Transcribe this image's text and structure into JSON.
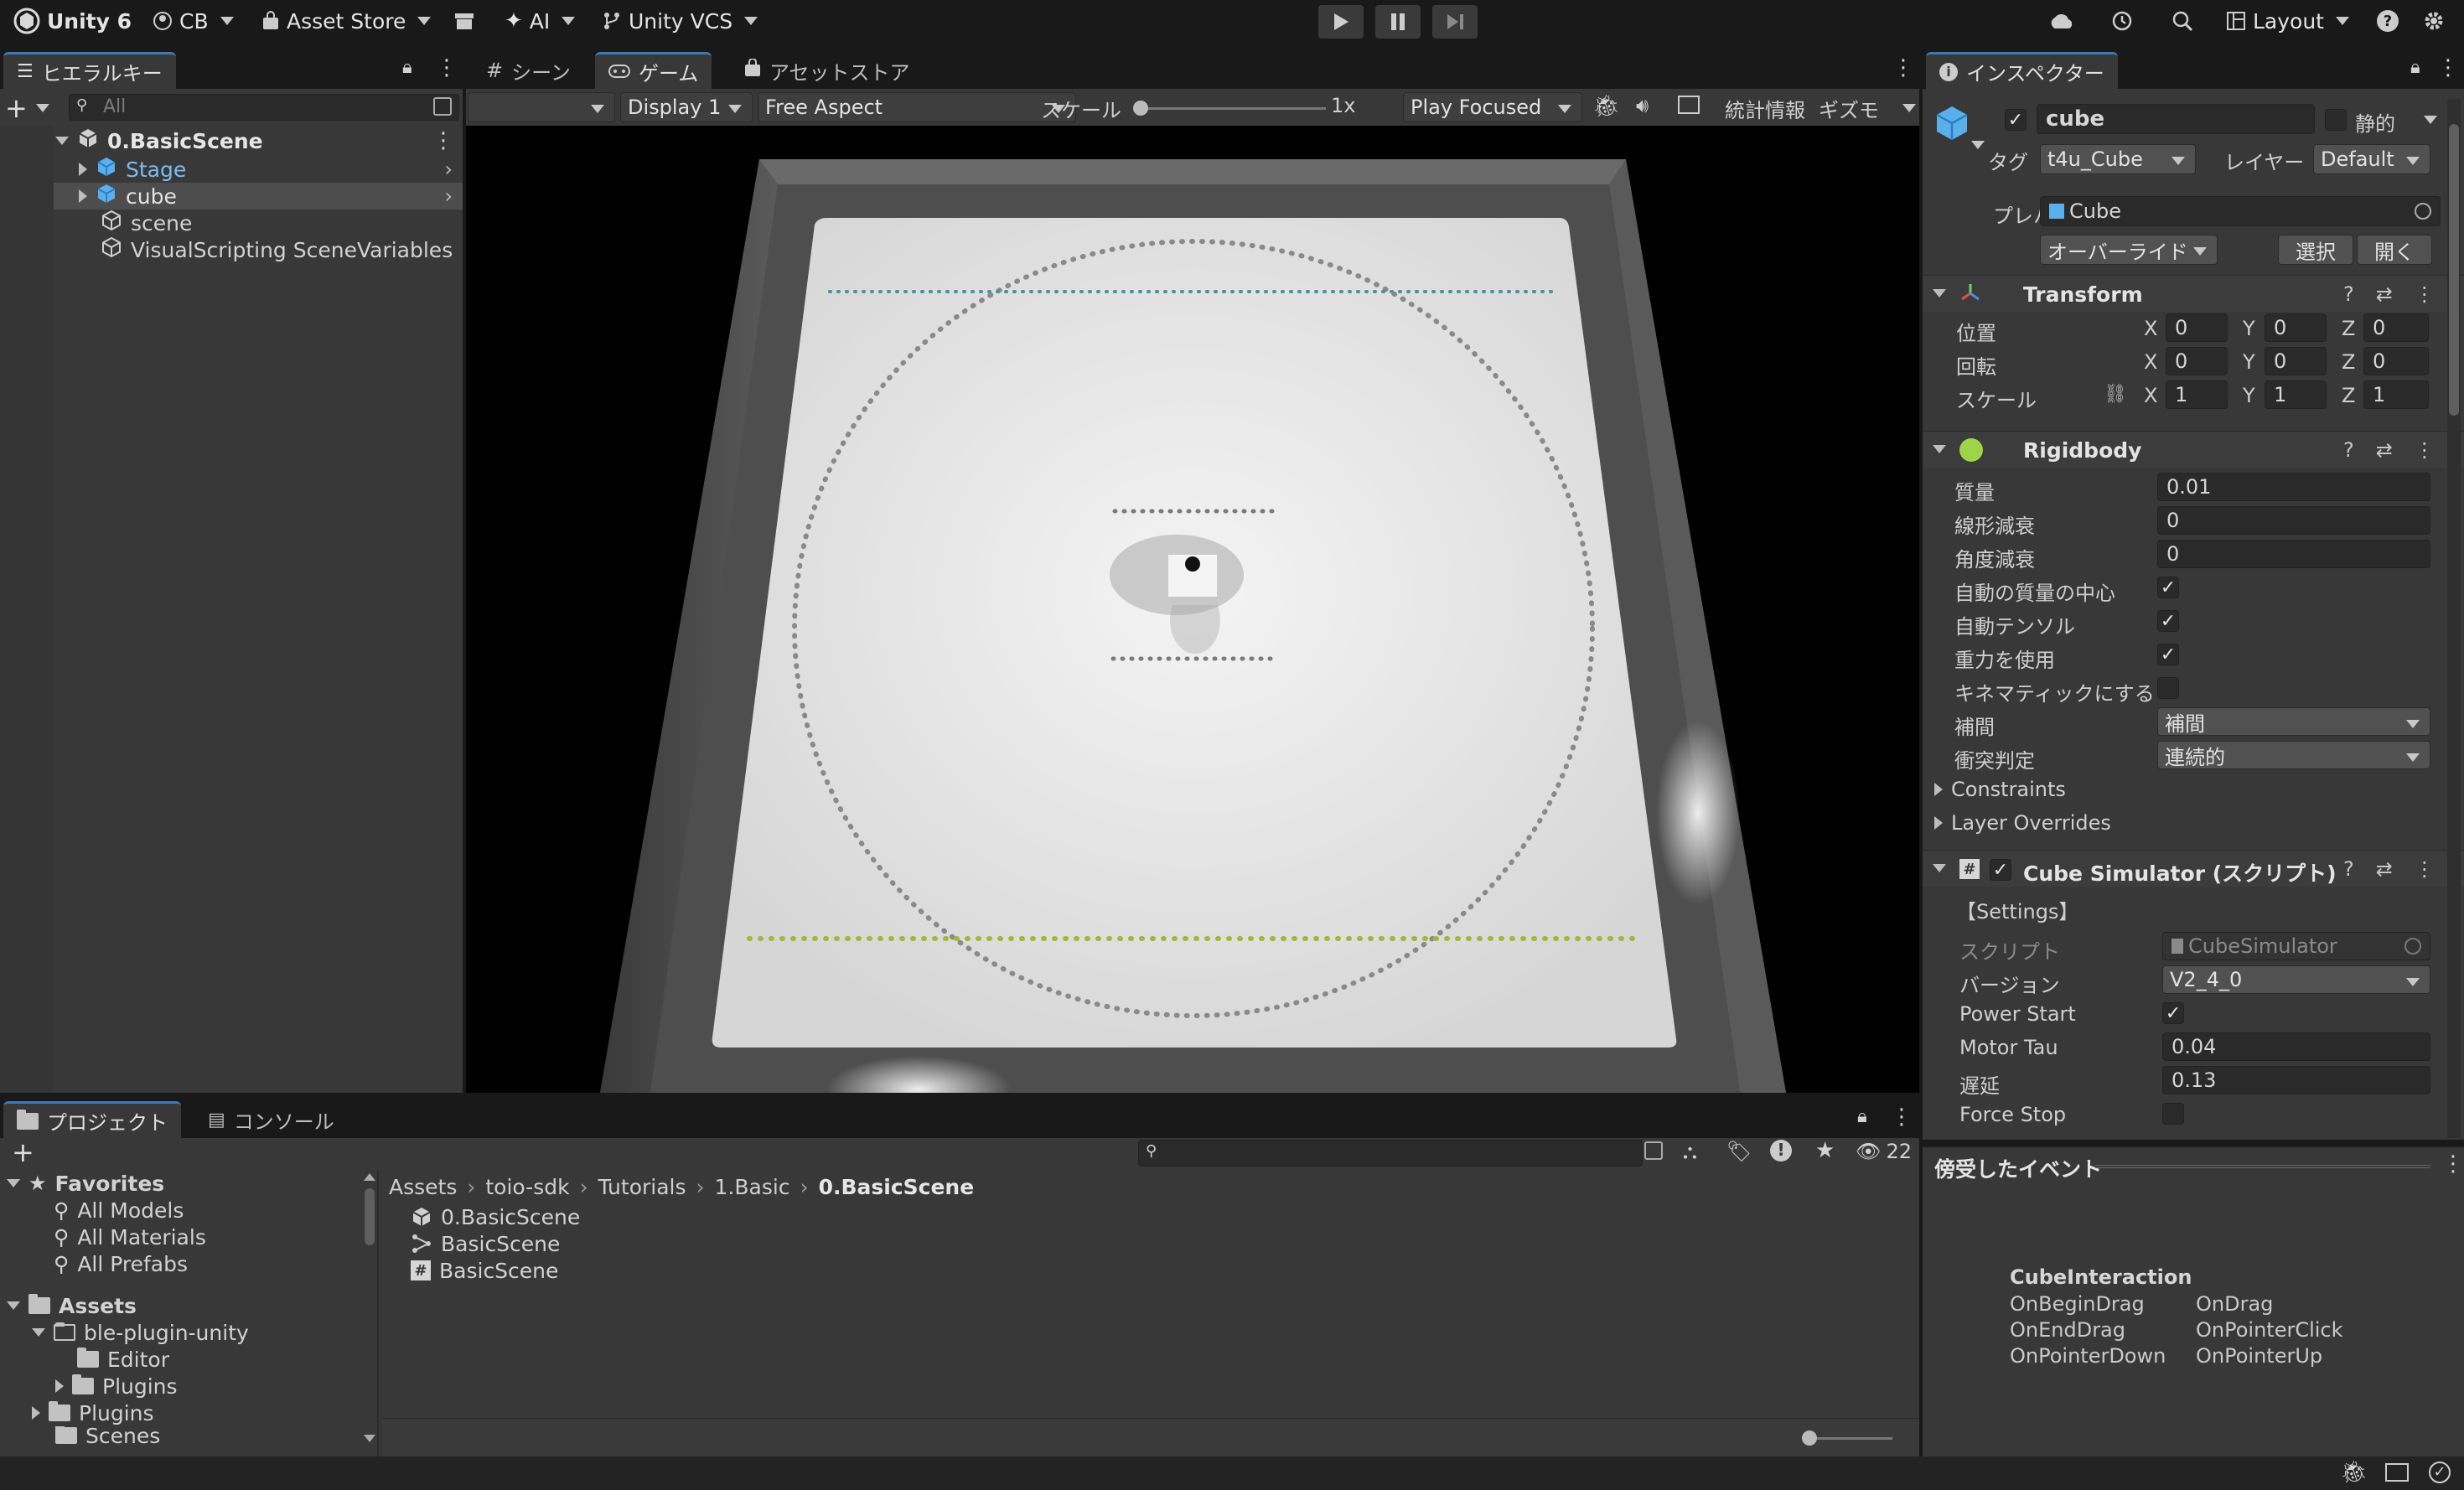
{
  "toolbar": {
    "product": "Unity 6",
    "account": "CB",
    "asset_store": "Asset Store",
    "ai": "AI",
    "vcs": "Unity VCS",
    "layout": "Layout"
  },
  "hierarchy": {
    "tab": "ヒエラルキー",
    "search_placeholder": "All",
    "scene": "0.BasicScene",
    "items": [
      {
        "label": "Stage",
        "type": "prefab"
      },
      {
        "label": "cube",
        "type": "prefab"
      },
      {
        "label": "scene",
        "type": "object"
      },
      {
        "label": "VisualScripting SceneVariables",
        "type": "object"
      }
    ]
  },
  "center_tabs": {
    "scene": "シーン",
    "game": "ゲーム",
    "asset_store": "アセットストア"
  },
  "game_toolbar": {
    "display": "Display 1",
    "aspect": "Free Aspect",
    "scale_label": "スケール",
    "scale_value": "1x",
    "play_mode": "Play Focused",
    "stats": "統計情報",
    "gizmos": "ギズモ"
  },
  "inspector": {
    "tab": "インスペクター",
    "object_name": "cube",
    "static_label": "静的",
    "tag_label": "タグ",
    "tag_value": "t4u_Cube",
    "layer_label": "レイヤー",
    "layer_value": "Default",
    "prefab_label": "プレハブ",
    "prefab_value": "Cube",
    "overrides": "オーバーライド",
    "select": "選択",
    "open": "開く",
    "transform": {
      "title": "Transform",
      "position_label": "位置",
      "rotation_label": "回転",
      "scale_label": "スケール",
      "position": [
        "0",
        "0",
        "0"
      ],
      "rotation": [
        "0",
        "0",
        "0"
      ],
      "scale": [
        "1",
        "1",
        "1"
      ]
    },
    "rigidbody": {
      "title": "Rigidbody",
      "mass_label": "質量",
      "mass": "0.01",
      "linear_damping_label": "線形減衰",
      "linear_damping": "0",
      "angular_damping_label": "角度減衰",
      "angular_damping": "0",
      "auto_center_label": "自動の質量の中心",
      "auto_tensor_label": "自動テンソル",
      "use_gravity_label": "重力を使用",
      "is_kinematic_label": "キネマティックにする",
      "interpolate_label": "補間",
      "interpolate_value": "補間",
      "collision_label": "衝突判定",
      "collision_value": "連続的",
      "constraints": "Constraints",
      "layer_overrides": "Layer Overrides"
    },
    "cube_simulator": {
      "title": "Cube Simulator (スクリプト)",
      "settings": "【Settings】",
      "script_label": "スクリプト",
      "script_value": "CubeSimulator",
      "version_label": "バージョン",
      "version_value": "V2_4_0",
      "power_start_label": "Power Start",
      "motor_tau_label": "Motor Tau",
      "motor_tau": "0.04",
      "delay_label": "遅延",
      "delay": "0.13",
      "force_stop_label": "Force Stop"
    },
    "events": {
      "title": "傍受したイベント",
      "group": "CubeInteraction",
      "left": [
        "OnBeginDrag",
        "OnEndDrag",
        "OnPointerDown"
      ],
      "right": [
        "OnDrag",
        "OnPointerClick",
        "OnPointerUp"
      ]
    }
  },
  "project": {
    "tab": "プロジェクト",
    "console_tab": "コンソール",
    "count": "22",
    "favorites": "Favorites",
    "favorites_items": [
      "All Models",
      "All Materials",
      "All Prefabs"
    ],
    "assets": "Assets",
    "tree": [
      "ble-plugin-unity",
      "Editor",
      "Plugins",
      "Plugins",
      "Scenes"
    ],
    "breadcrumb": [
      "Assets",
      "toio-sdk",
      "Tutorials",
      "1.Basic",
      "0.BasicScene"
    ],
    "files": [
      {
        "name": "0.BasicScene",
        "icon": "unity-scene-icon"
      },
      {
        "name": "BasicScene",
        "icon": "graph-icon"
      },
      {
        "name": "BasicScene",
        "icon": "script-icon"
      }
    ]
  }
}
